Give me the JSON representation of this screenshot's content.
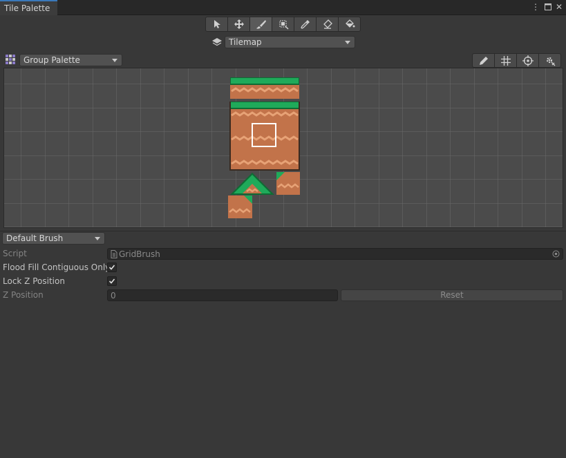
{
  "window": {
    "tab_title": "Tile Palette"
  },
  "toolbar": {
    "tools": [
      "select-tool",
      "move-tool",
      "paint-brush-tool",
      "box-fill-tool",
      "picker-tool",
      "eraser-tool",
      "flood-fill-tool"
    ],
    "active_tool": "paint-brush-tool"
  },
  "target": {
    "selected": "Tilemap"
  },
  "palette": {
    "selected": "Group Palette"
  },
  "palette_tools": [
    "edit-pencil-icon",
    "grid-icon",
    "gizmo-icon",
    "settings-icon"
  ],
  "colors": {
    "grass": "#1faa5a",
    "grass_dark": "#0f6b34",
    "dirt": "#c2734a",
    "dirt_light": "#e7a276",
    "grid_bg": "#4b4b4b",
    "grid_line": "#6c6c6c",
    "selection": "#ffffff"
  },
  "brush": {
    "selected": "Default Brush",
    "script_label": "Script",
    "script_value": "GridBrush",
    "flood_fill_label": "Flood Fill Contiguous Only",
    "flood_fill_checked": true,
    "lock_z_label": "Lock Z Position",
    "lock_z_checked": true,
    "z_position_label": "Z Position",
    "z_position_value": "0",
    "reset_label": "Reset"
  }
}
